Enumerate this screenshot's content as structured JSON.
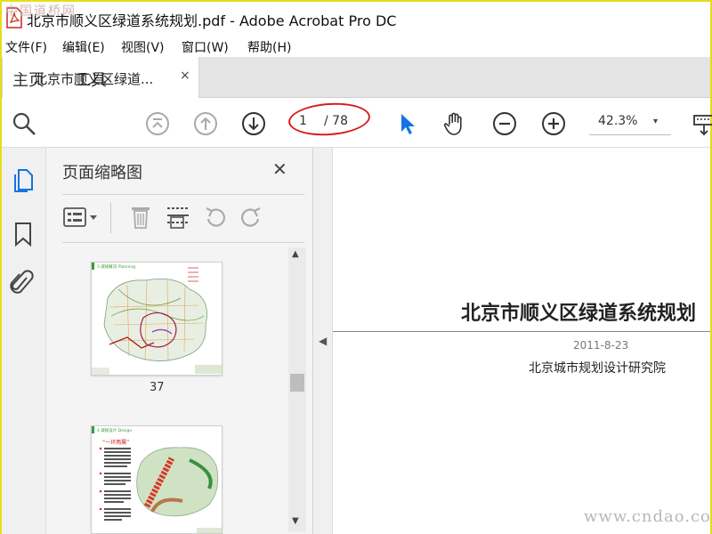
{
  "window": {
    "title": "北京市顺义区绿道系统规划.pdf - Adobe Acrobat Pro DC",
    "watermark_top": "中国道桥网"
  },
  "menu": [
    "文件(F)",
    "编辑(E)",
    "视图(V)",
    "窗口(W)",
    "帮助(H)"
  ],
  "tabs": {
    "home": "主页",
    "tools": "工具",
    "document": "北京市顺义区绿道...",
    "close": "×"
  },
  "toolbar": {
    "page_current": "1",
    "page_total": "/ 78",
    "zoom": "42.3%",
    "zoom_caret": "▾",
    "icons": [
      "search-zoom-icon",
      "first-page-icon",
      "prev-page-icon",
      "next-page-icon",
      "select-arrow-icon",
      "hand-icon",
      "zoom-out-icon",
      "zoom-in-icon",
      "keyboard-icon"
    ]
  },
  "thumb_panel": {
    "title": "页面缩略图",
    "close": "✕",
    "thumbnails": [
      {
        "page_label": "37",
        "heading": "3 城规概况 Planning"
      },
      {
        "page_label": "",
        "heading": "4 城规设计 Design",
        "note": "“一环两翼”"
      }
    ]
  },
  "document": {
    "title": "北京市顺义区绿道系统规划",
    "date": "2011-8-23",
    "organization": "北京城市规划设计研究院"
  },
  "watermark_bottom": "www.cndao.com",
  "colors": {
    "accent": "#1473e6",
    "annotation_circle": "#d51f1f",
    "window_border": "#e6de17"
  }
}
